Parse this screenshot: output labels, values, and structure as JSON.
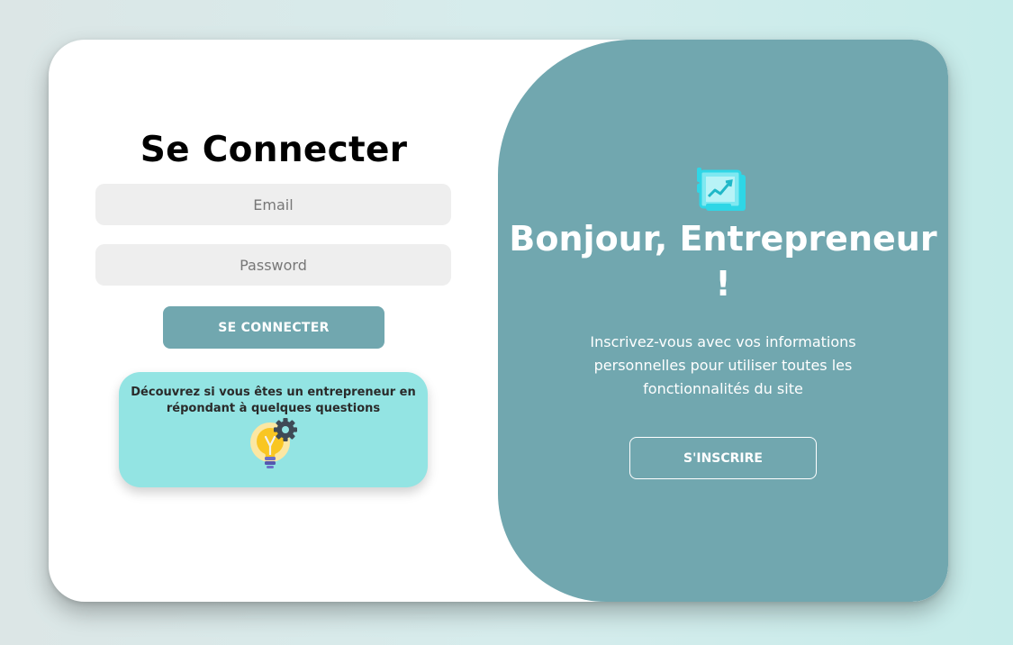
{
  "login": {
    "title": "Se Connecter",
    "email_placeholder": "Email",
    "password_placeholder": "Password",
    "submit_label": "SE CONNECTER"
  },
  "quiz": {
    "text": "Découvrez si vous êtes un entrepreneur en répondant à quelques questions",
    "icon": "lightbulb-gear-icon"
  },
  "welcome": {
    "icon": "chart-board-icon",
    "title": "Bonjour, Entrepreneur !",
    "subtitle": "Inscrivez-vous avec vos informations personnelles pour utiliser toutes les fonctionnalités du site",
    "signup_label": "S'INSCRIRE"
  },
  "colors": {
    "accent": "#71a7af",
    "quiz_bg": "#93e4e3",
    "field_bg": "#eeeeee",
    "icon_cyan": "#2fd6e6"
  }
}
